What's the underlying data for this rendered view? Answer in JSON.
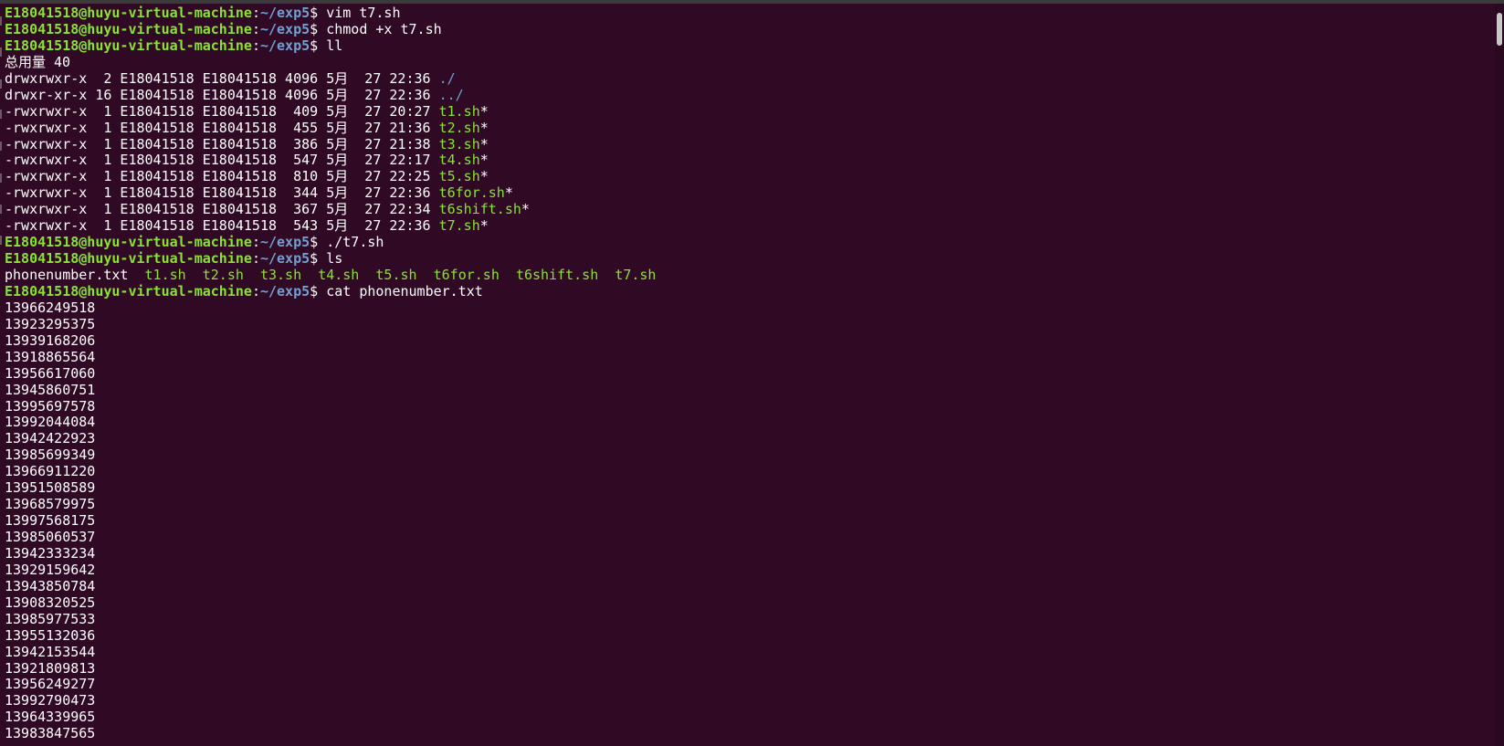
{
  "terminal": {
    "prompt": {
      "user_host": "E18041518@huyu-virtual-machine",
      "colon": ":",
      "path": "~/exp5",
      "symbol": "$ "
    },
    "commands": {
      "vim": "vim t7.sh",
      "chmod": "chmod +x t7.sh",
      "ll": "ll",
      "run": "./t7.sh",
      "ls": "ls",
      "cat": "cat phonenumber.txt"
    },
    "ll_total": "总用量 40",
    "ll_rows": [
      {
        "meta": "drwxrwxr-x  2 E18041518 E18041518 4096 5月  27 22:36 ",
        "name": "./",
        "kind": "dir",
        "suffix": ""
      },
      {
        "meta": "drwxr-xr-x 16 E18041518 E18041518 4096 5月  27 22:36 ",
        "name": "../",
        "kind": "dir",
        "suffix": ""
      },
      {
        "meta": "-rwxrwxr-x  1 E18041518 E18041518  409 5月  27 20:27 ",
        "name": "t1.sh",
        "kind": "exe",
        "suffix": "*"
      },
      {
        "meta": "-rwxrwxr-x  1 E18041518 E18041518  455 5月  27 21:36 ",
        "name": "t2.sh",
        "kind": "exe",
        "suffix": "*"
      },
      {
        "meta": "-rwxrwxr-x  1 E18041518 E18041518  386 5月  27 21:38 ",
        "name": "t3.sh",
        "kind": "exe",
        "suffix": "*"
      },
      {
        "meta": "-rwxrwxr-x  1 E18041518 E18041518  547 5月  27 22:17 ",
        "name": "t4.sh",
        "kind": "exe",
        "suffix": "*"
      },
      {
        "meta": "-rwxrwxr-x  1 E18041518 E18041518  810 5月  27 22:25 ",
        "name": "t5.sh",
        "kind": "exe",
        "suffix": "*"
      },
      {
        "meta": "-rwxrwxr-x  1 E18041518 E18041518  344 5月  27 22:36 ",
        "name": "t6for.sh",
        "kind": "exe",
        "suffix": "*"
      },
      {
        "meta": "-rwxrwxr-x  1 E18041518 E18041518  367 5月  27 22:34 ",
        "name": "t6shift.sh",
        "kind": "exe",
        "suffix": "*"
      },
      {
        "meta": "-rwxrwxr-x  1 E18041518 E18041518  543 5月  27 22:36 ",
        "name": "t7.sh",
        "kind": "exe",
        "suffix": "*"
      }
    ],
    "ls_output": [
      {
        "name": "phonenumber.txt",
        "kind": "plain"
      },
      {
        "name": "t1.sh",
        "kind": "exe"
      },
      {
        "name": "t2.sh",
        "kind": "exe"
      },
      {
        "name": "t3.sh",
        "kind": "exe"
      },
      {
        "name": "t4.sh",
        "kind": "exe"
      },
      {
        "name": "t5.sh",
        "kind": "exe"
      },
      {
        "name": "t6for.sh",
        "kind": "exe"
      },
      {
        "name": "t6shift.sh",
        "kind": "exe"
      },
      {
        "name": "t7.sh",
        "kind": "exe"
      }
    ],
    "phone_numbers": [
      "13966249518",
      "13923295375",
      "13939168206",
      "13918865564",
      "13956617060",
      "13945860751",
      "13995697578",
      "13992044084",
      "13942422923",
      "13985699349",
      "13966911220",
      "13951508589",
      "13968579975",
      "13997568175",
      "13985060537",
      "13942333234",
      "13929159642",
      "13943850784",
      "13908320525",
      "13985977533",
      "13955132036",
      "13942153544",
      "13921809813",
      "13956249277",
      "13992790473",
      "13964339965",
      "13983847565"
    ],
    "colors": {
      "background": "#300a24",
      "prompt_user": "#8ae234",
      "prompt_path": "#729fcf",
      "executable": "#8ae234",
      "directory": "#729fcf",
      "text": "#ffffff"
    }
  }
}
